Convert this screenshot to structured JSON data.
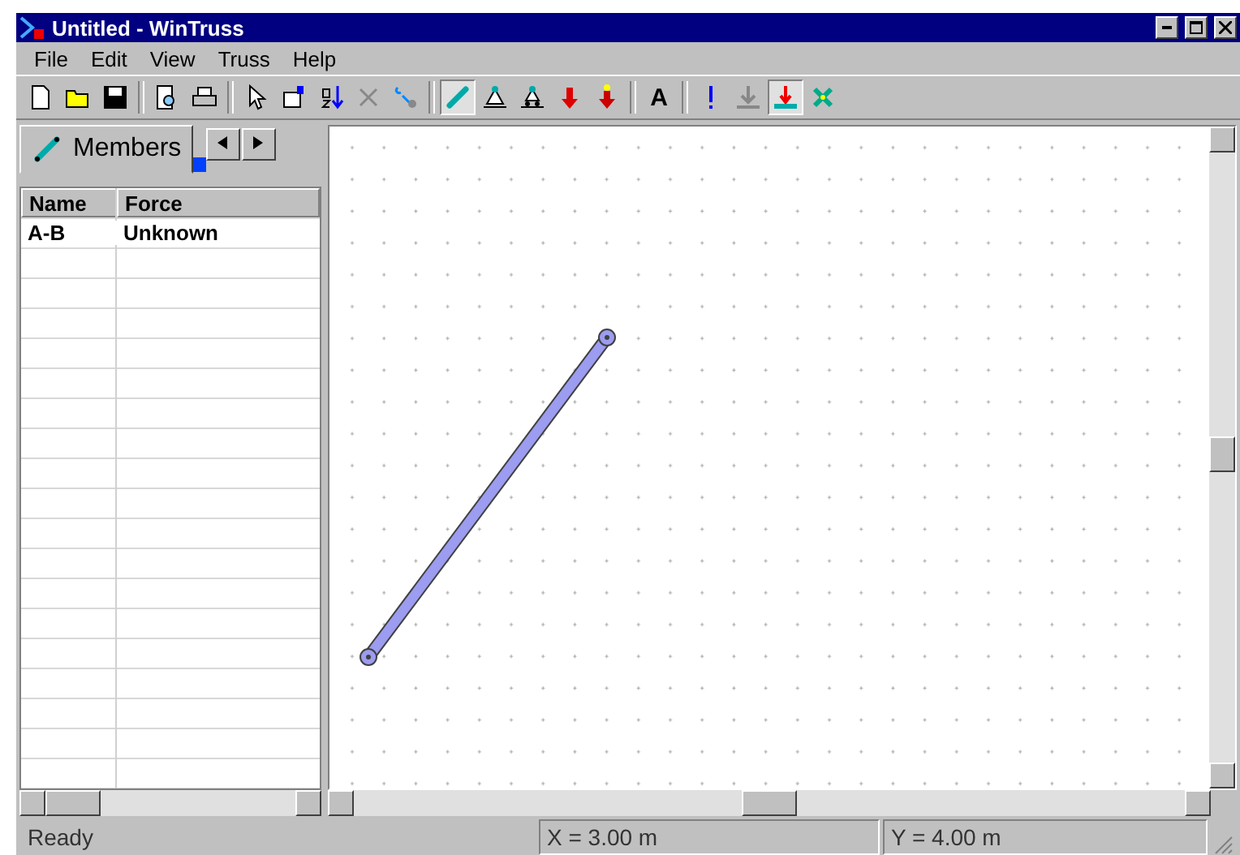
{
  "window": {
    "title": "Untitled - WinTruss"
  },
  "menu": [
    "File",
    "Edit",
    "View",
    "Truss",
    "Help"
  ],
  "toolbar": [
    {
      "kind": "new",
      "pressed": false
    },
    {
      "kind": "open",
      "pressed": false
    },
    {
      "kind": "save",
      "pressed": false
    },
    {
      "kind": "sep"
    },
    {
      "kind": "preview",
      "pressed": false
    },
    {
      "kind": "print",
      "pressed": false
    },
    {
      "kind": "sep"
    },
    {
      "kind": "pointer",
      "pressed": false
    },
    {
      "kind": "properties",
      "pressed": false
    },
    {
      "kind": "sort",
      "pressed": false
    },
    {
      "kind": "delete",
      "pressed": false
    },
    {
      "kind": "joint",
      "pressed": false
    },
    {
      "kind": "sep"
    },
    {
      "kind": "member",
      "pressed": true
    },
    {
      "kind": "pin",
      "pressed": false
    },
    {
      "kind": "roller",
      "pressed": false
    },
    {
      "kind": "load",
      "pressed": false
    },
    {
      "kind": "load2",
      "pressed": false
    },
    {
      "kind": "sep"
    },
    {
      "kind": "text",
      "label": "A",
      "pressed": false
    },
    {
      "kind": "sep"
    },
    {
      "kind": "exclaim",
      "pressed": false
    },
    {
      "kind": "support",
      "pressed": false
    },
    {
      "kind": "reaction",
      "pressed": true
    },
    {
      "kind": "cross",
      "pressed": false
    }
  ],
  "panel": {
    "tabs": [
      {
        "label": "Members",
        "selected": true
      }
    ],
    "table": {
      "columns": [
        "Name",
        "Force"
      ],
      "rows": [
        [
          "A-B",
          "Unknown"
        ]
      ]
    }
  },
  "status_bar": [
    "Ready",
    "X = 3.00 m",
    "Y = 4.00 m"
  ]
}
